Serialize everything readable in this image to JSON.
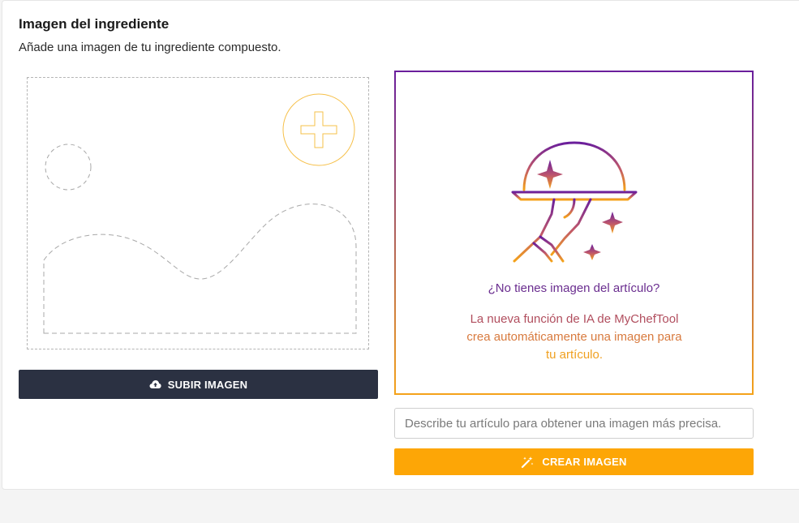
{
  "section": {
    "title": "Imagen del ingrediente",
    "subtitle": "Añade una imagen de tu ingrediente compuesto."
  },
  "upload": {
    "button_label": "SUBIR IMAGEN",
    "button_icon": "cloud-upload-icon",
    "placeholder_icon": "image-placeholder-icon",
    "add_icon": "plus-circle-icon"
  },
  "ai": {
    "illustration_icon": "serving-cloche-icon",
    "question": "¿No tienes imagen del artículo?",
    "desc_line1": "La nueva función de IA de MyChefTool",
    "desc_line2": "crea automáticamente una imagen para",
    "desc_line3": "tu artículo.",
    "input_placeholder": "Describe tu artículo para obtener una imagen más precisa.",
    "create_label": "CREAR IMAGEN",
    "create_icon": "magic-wand-icon"
  },
  "colors": {
    "dark_button": "#2b3142",
    "accent_orange": "#fda606",
    "accent_purple": "#6a1e9c"
  }
}
